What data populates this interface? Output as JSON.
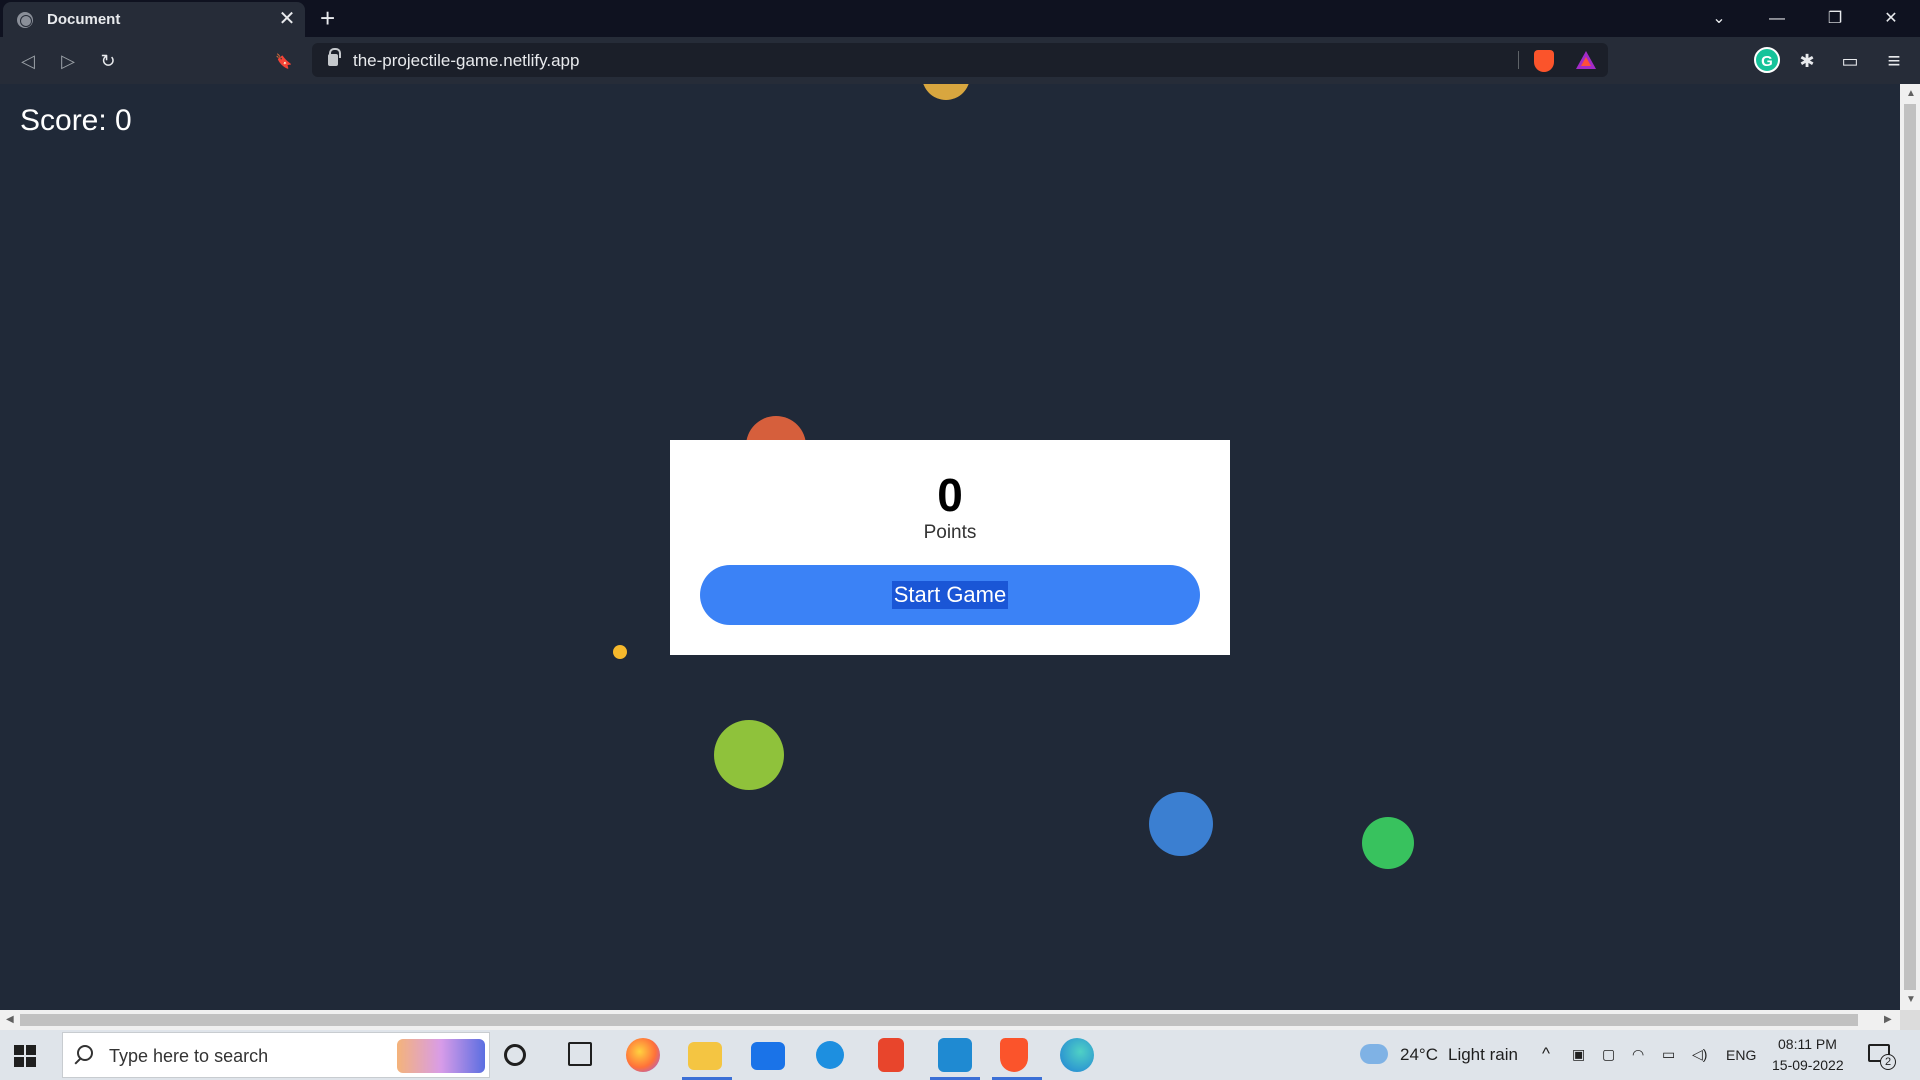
{
  "browser": {
    "tab_title": "Document",
    "tab_close": "✕",
    "new_tab": "+",
    "url": "the-projectile-game.netlify.app",
    "window_controls": {
      "tab_search": "⌄",
      "minimize": "—",
      "restore": "❐",
      "close": "✕"
    },
    "nav": {
      "back": "◁",
      "forward": "▷",
      "reload": "↻",
      "bookmark": "🔖"
    },
    "extensions": {
      "grammarly": "G",
      "puzzle": "✱",
      "wallet": "▭",
      "menu": "≡"
    }
  },
  "game": {
    "score_label": "Score: 0",
    "points_value": "0",
    "points_label": "Points",
    "start_button": "Start Game",
    "colors": {
      "background": "#202938",
      "button": "#3b82f6",
      "modal": "#ffffff"
    }
  },
  "taskbar": {
    "search_placeholder": "Type here to search",
    "weather": "24°C",
    "weather_text": "Light rain",
    "language": "ENG",
    "time": "08:11 PM",
    "date": "15-09-2022",
    "notification_count": "2",
    "icons": [
      "windows-logo",
      "search",
      "cortana",
      "task-view",
      "firefox",
      "file-explorer",
      "mail",
      "safari",
      "office",
      "vscode",
      "brave",
      "edge"
    ]
  }
}
